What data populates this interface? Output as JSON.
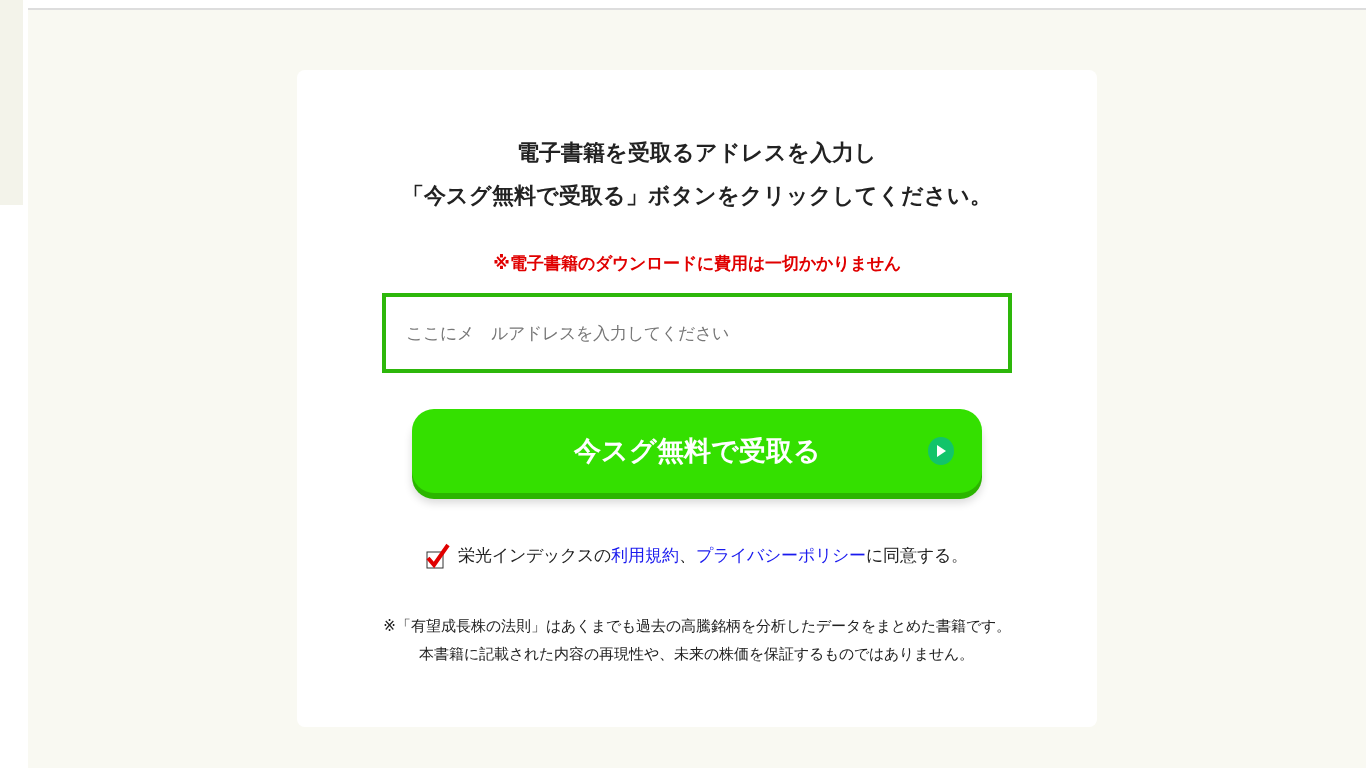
{
  "heading": [
    "電子書籍を受取るアドレスを入力し",
    "「今スグ無料で受取る」ボタンをクリックしてください。"
  ],
  "notice": "※電子書籍のダウンロードに費用は一切かかりません",
  "email_field": {
    "placeholder": "ここにメ　ルアドレスを入力してください"
  },
  "submit_button": {
    "label": "今スグ無料で受取る"
  },
  "consent": {
    "checked": true,
    "before": "栄光インデックスの",
    "link_terms": "利用規約",
    "separator": "、",
    "link_privacy": "プライバシーポリシー",
    "after": "に同意する。"
  },
  "disclaimer": [
    "※「有望成長株の法則」はあくまでも過去の高騰銘柄を分析したデータをまとめた書籍です。",
    "本書籍に記載された内容の再現性や、未来の株価を保証するものではありません。"
  ]
}
